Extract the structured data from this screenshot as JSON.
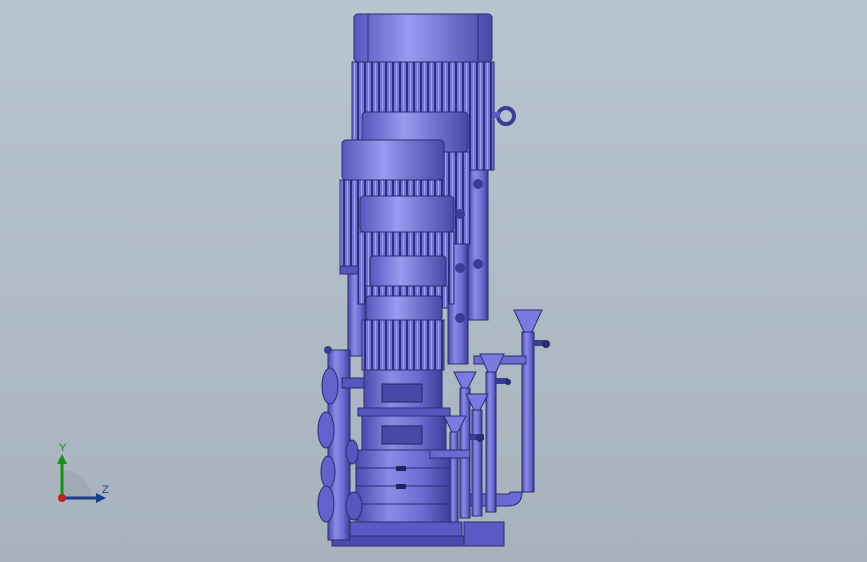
{
  "viewport": {
    "background_top": "#b8c4d0",
    "background_bottom": "#a7b2bd",
    "model_color": "#6b6bd6",
    "model_dark": "#3c3c8e",
    "model_light": "#8d8de8"
  },
  "triad": {
    "y_label": "Y",
    "z_label": "Z",
    "y_color": "#1a8f1a",
    "z_color": "#1a3d8f",
    "x_color": "#c02020"
  },
  "model": {
    "icon": "multistage-pump-assembly"
  }
}
